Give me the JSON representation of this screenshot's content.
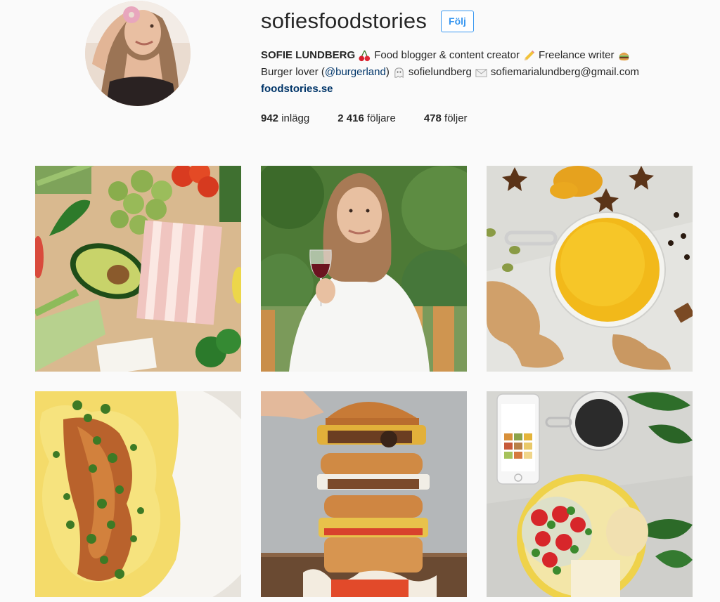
{
  "profile": {
    "username": "sofiesfoodstories",
    "follow_label": "Följ",
    "avatar_icon": "profile-photo"
  },
  "bio": {
    "full_name": "SOFIE LUNDBERG",
    "line1_part1": "Food blogger & content creator",
    "line1_part2": "Freelance writer",
    "line2_prefix": "Burger lover (",
    "line2_mention": "@burgerland",
    "line2_suffix": ")",
    "snapchat": "sofielundberg",
    "email": "sofiemarialundberg@gmail.com",
    "website": "foodstories.se",
    "emojis": [
      "cherry-icon",
      "pencil-icon",
      "burger-icon",
      "ghost-icon",
      "envelope-icon"
    ]
  },
  "stats": {
    "posts_count": "942",
    "posts_label": "inlägg",
    "followers_count": "2 416",
    "followers_label": "följare",
    "following_count": "478",
    "following_label": "följer"
  },
  "posts": [
    {
      "subject": "vegetables-and-bacon"
    },
    {
      "subject": "woman-with-wine"
    },
    {
      "subject": "golden-milk"
    },
    {
      "subject": "eggs-with-herbs"
    },
    {
      "subject": "burger-stack"
    },
    {
      "subject": "phone-and-salad"
    }
  ],
  "colors": {
    "accent": "#3897f0",
    "link": "#003569",
    "text": "#262626",
    "background": "#fafafa"
  }
}
